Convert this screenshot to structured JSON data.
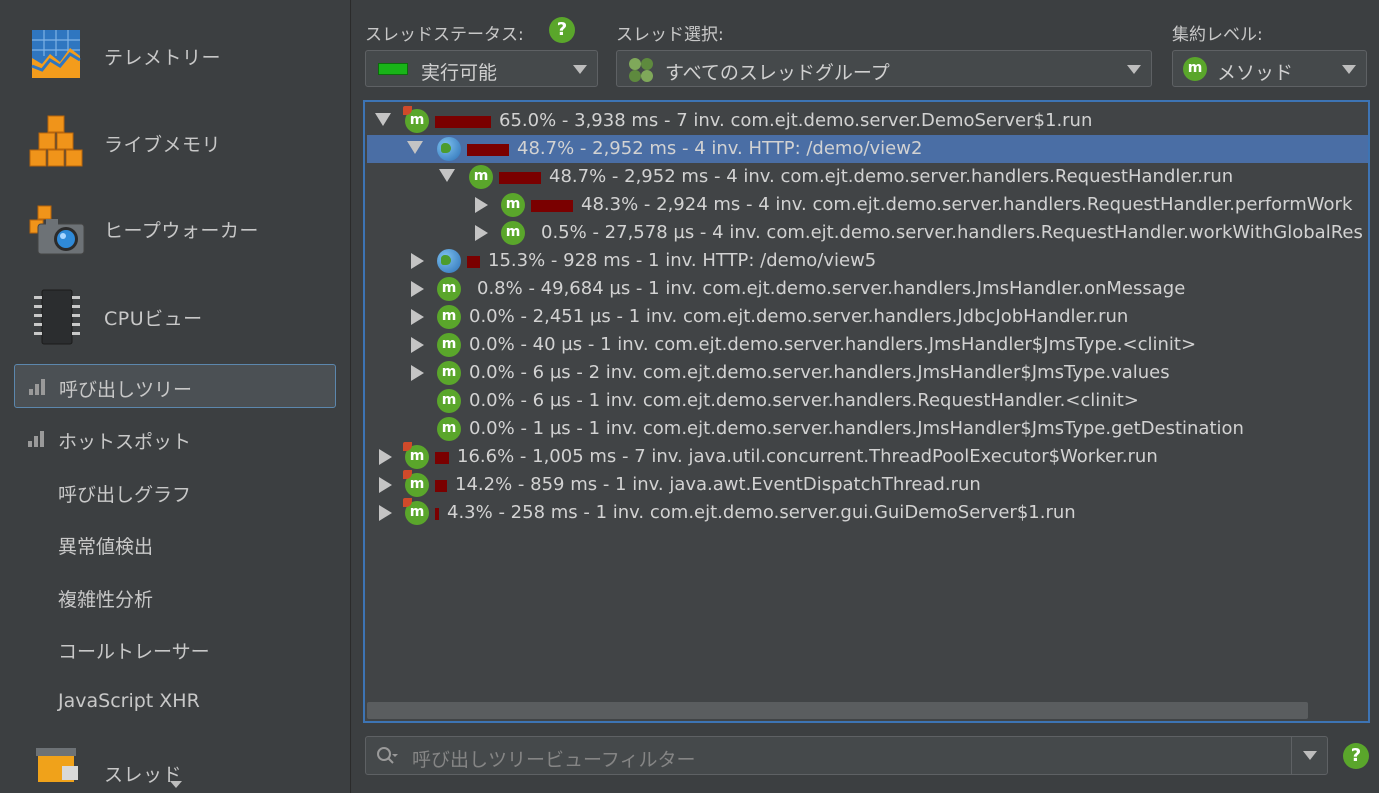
{
  "sidebar": {
    "big_items": [
      {
        "label": "テレメトリー",
        "icon": "telemetry-icon"
      },
      {
        "label": "ライブメモリ",
        "icon": "live-memory-icon"
      },
      {
        "label": "ヒープウォーカー",
        "icon": "heap-walker-icon"
      },
      {
        "label": "CPUビュー",
        "icon": "cpu-icon"
      }
    ],
    "sub_items": [
      {
        "label": "呼び出しツリー",
        "selected": true
      },
      {
        "label": "ホットスポット"
      },
      {
        "label": "呼び出しグラフ"
      },
      {
        "label": "異常値検出"
      },
      {
        "label": "複雑性分析"
      },
      {
        "label": "コールトレーサー"
      },
      {
        "label": "JavaScript XHR"
      }
    ],
    "partial_item": {
      "label": "スレッド",
      "icon": "threads-icon"
    }
  },
  "toolbar": {
    "thread_status_label": "スレッドステータス:",
    "thread_status_value": "実行可能",
    "thread_select_label": "スレッド選択:",
    "thread_select_value": "すべてのスレッドグループ",
    "aggregation_label": "集約レベル:",
    "aggregation_value": "メソッド",
    "help_glyph": "?",
    "status_color": "#18b418",
    "accent_color": "#5aa62b"
  },
  "tree": {
    "rows": [
      {
        "text": "65.0% - 3,938 ms - 7 inv. com.ejt.demo.server.DemoServer$1.run",
        "expand": "down",
        "icon": "method-thread-icon",
        "bar_pct": 65.0
      },
      {
        "text": "48.7% - 2,952 ms - 4 inv. HTTP: /demo/view2",
        "expand": "down",
        "icon": "globe-icon",
        "bar_pct": 48.7,
        "selected": true
      },
      {
        "text": "48.7% - 2,952 ms - 4 inv. com.ejt.demo.server.handlers.RequestHandler.run",
        "expand": "down",
        "icon": "method-icon",
        "bar_pct": 48.7
      },
      {
        "text": "48.3% - 2,924 ms - 4 inv. com.ejt.demo.server.handlers.RequestHandler.performWork",
        "expand": "right",
        "icon": "method-icon",
        "bar_pct": 48.3
      },
      {
        "text": "0.5% - 27,578 µs - 4 inv. com.ejt.demo.server.handlers.RequestHandler.workWithGlobalRes",
        "expand": "right",
        "icon": "method-icon",
        "bar_pct": 0.5
      },
      {
        "text": "15.3% - 928 ms - 1 inv. HTTP: /demo/view5",
        "expand": "right",
        "icon": "globe-icon",
        "bar_pct": 15.3
      },
      {
        "text": "0.8% - 49,684 µs - 1 inv. com.ejt.demo.server.handlers.JmsHandler.onMessage",
        "expand": "right",
        "icon": "method-icon",
        "bar_pct": 0.8
      },
      {
        "text": "0.0% - 2,451 µs - 1 inv. com.ejt.demo.server.handlers.JdbcJobHandler.run",
        "expand": "right",
        "icon": "method-icon",
        "bar_pct": 0.0
      },
      {
        "text": "0.0% - 40 µs - 1 inv. com.ejt.demo.server.handlers.JmsHandler$JmsType.<clinit>",
        "expand": "right",
        "icon": "method-icon",
        "bar_pct": 0.0
      },
      {
        "text": "0.0% - 6 µs - 2 inv. com.ejt.demo.server.handlers.JmsHandler$JmsType.values",
        "expand": "right",
        "icon": "method-icon",
        "bar_pct": 0.0
      },
      {
        "text": "0.0% - 6 µs - 1 inv. com.ejt.demo.server.handlers.RequestHandler.<clinit>",
        "expand": "none",
        "icon": "method-icon",
        "bar_pct": 0.0
      },
      {
        "text": "0.0% - 1 µs - 1 inv. com.ejt.demo.server.handlers.JmsHandler$JmsType.getDestination",
        "expand": "none",
        "icon": "method-icon",
        "bar_pct": 0.0
      },
      {
        "text": "16.6% - 1,005 ms - 7 inv. java.util.concurrent.ThreadPoolExecutor$Worker.run",
        "expand": "right",
        "icon": "method-thread-icon",
        "bar_pct": 16.6
      },
      {
        "text": "14.2% - 859 ms - 1 inv. java.awt.EventDispatchThread.run",
        "expand": "right",
        "icon": "method-thread-icon",
        "bar_pct": 14.2
      },
      {
        "text": "4.3% - 258 ms - 1 inv. com.ejt.demo.server.gui.GuiDemoServer$1.run",
        "expand": "right",
        "icon": "method-thread-icon",
        "bar_pct": 4.3
      }
    ],
    "method_glyph": "m",
    "bar_color": "#7a0000",
    "selection_color": "#4a6ea5"
  },
  "filter": {
    "placeholder": "呼び出しツリービューフィルター",
    "help_glyph": "?"
  }
}
